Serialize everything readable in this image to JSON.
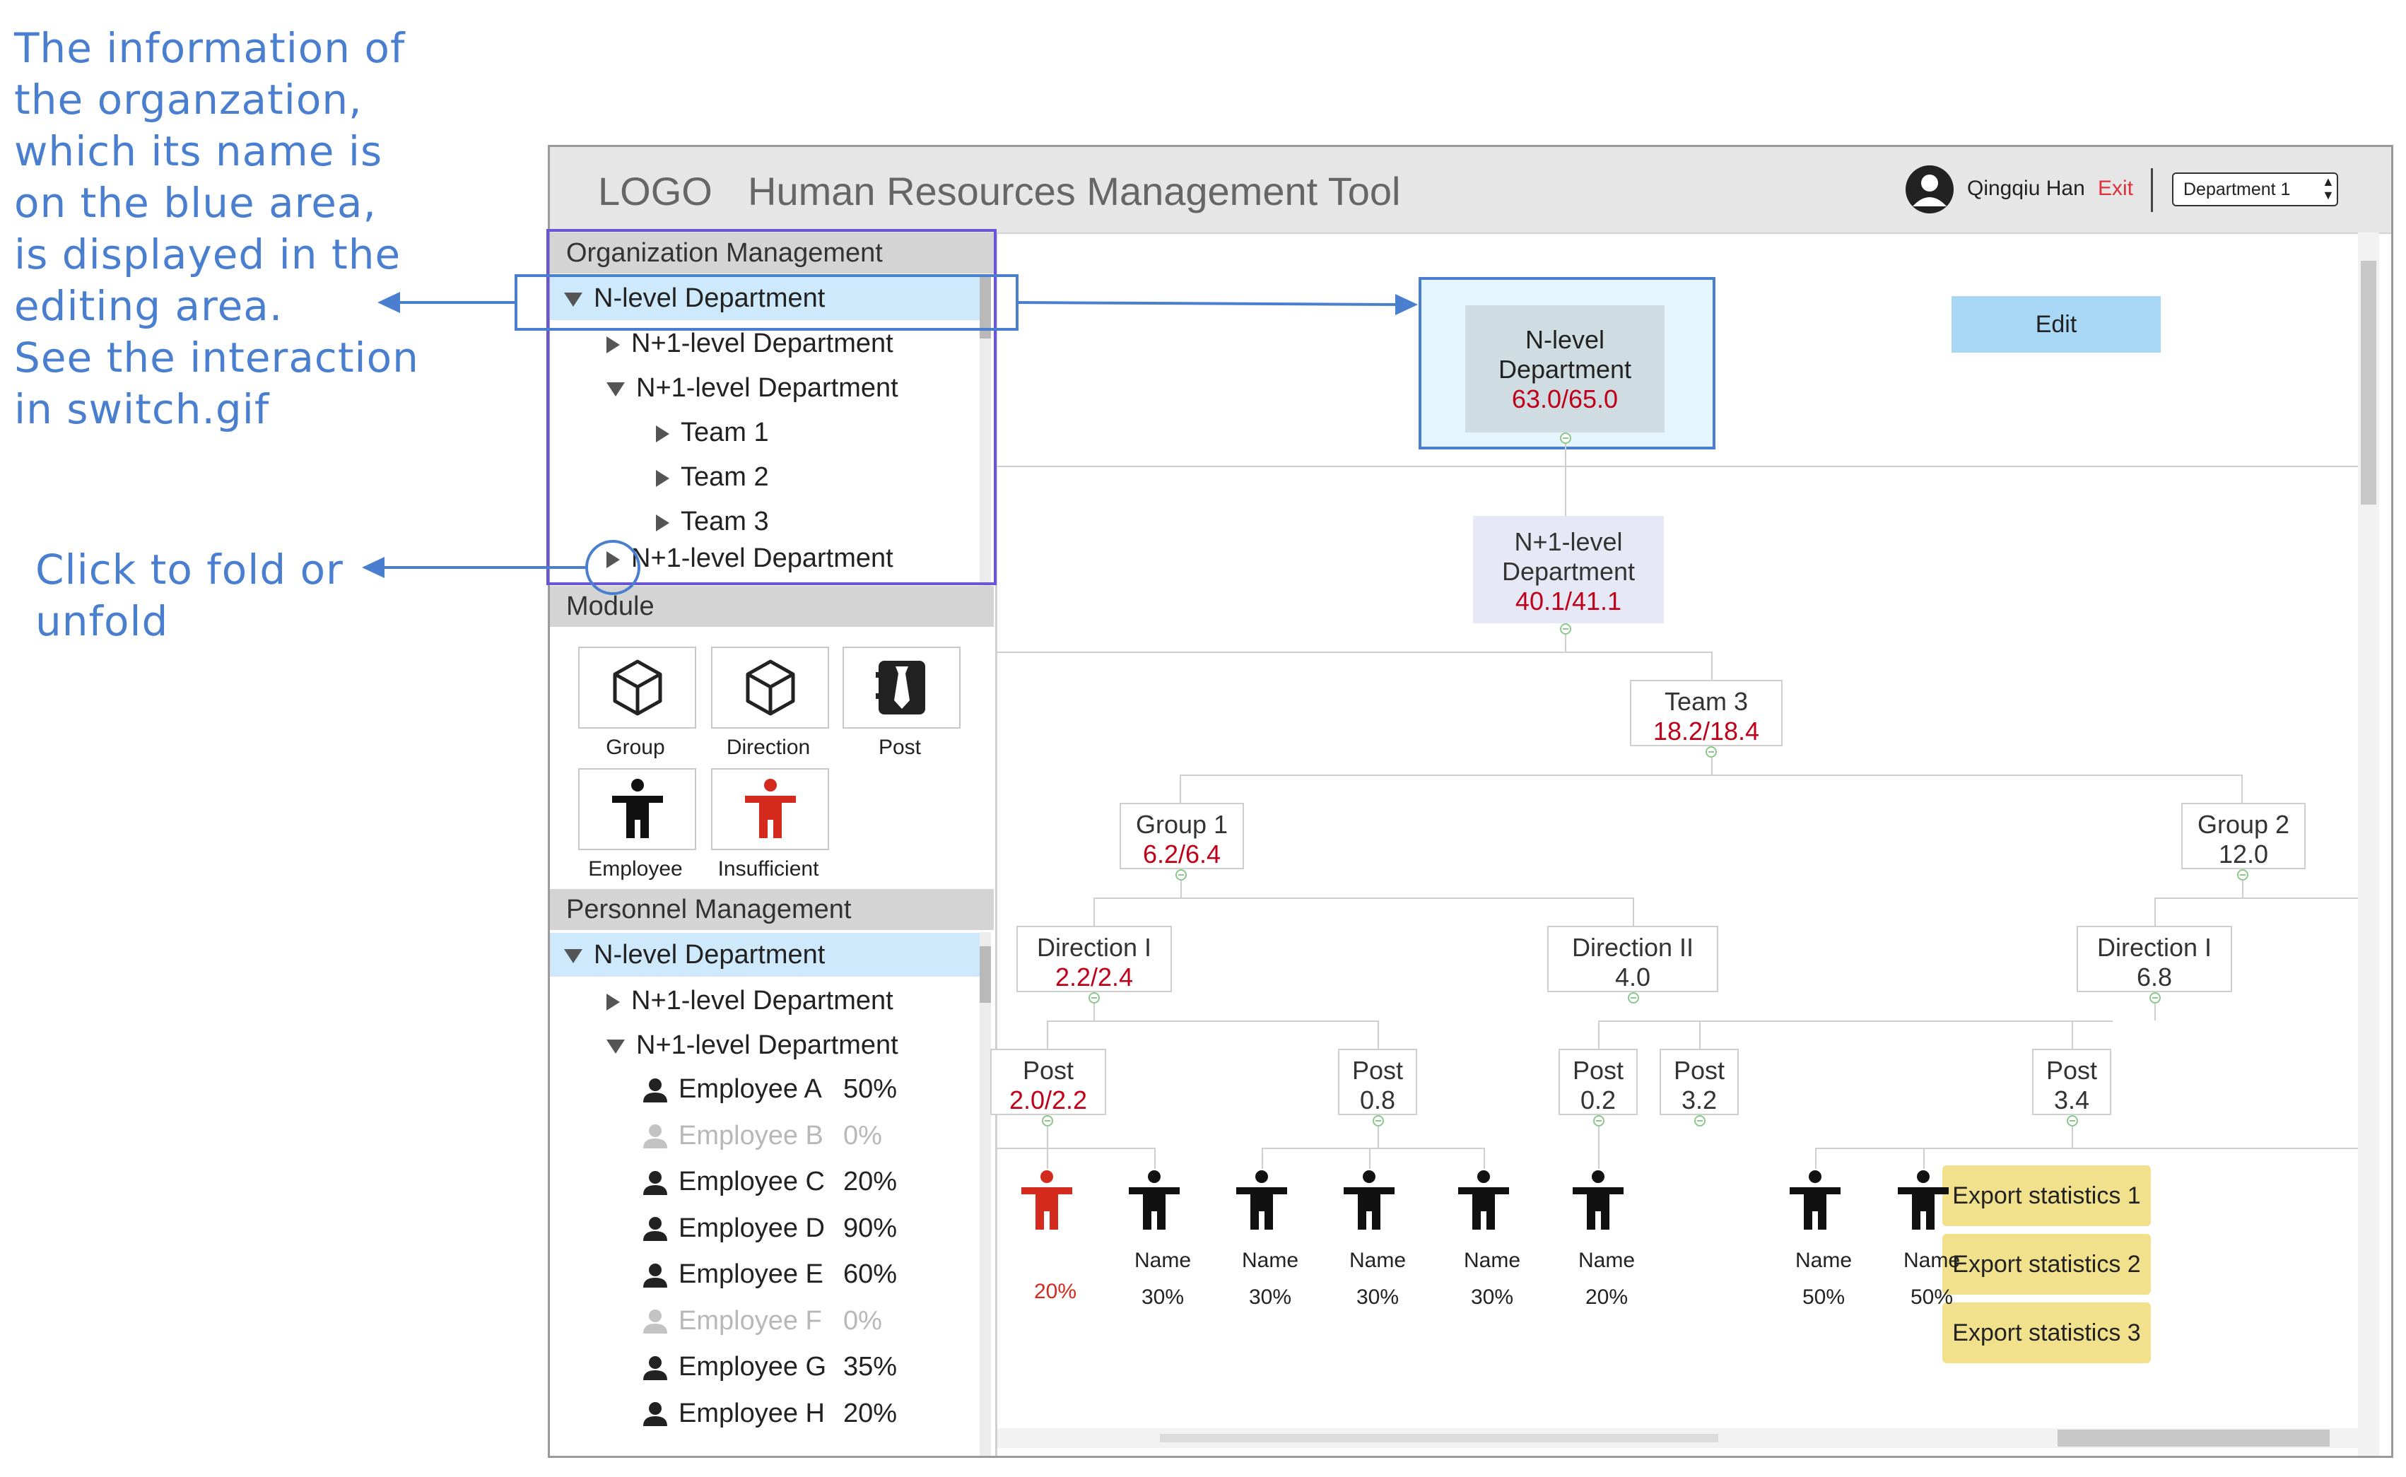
{
  "annotations": {
    "info": "The information of\nthe organzation,\nwhich its name is\non the blue area,\nis displayed in the\nediting area.\nSee the interaction\nin switch.gif",
    "fold": "Click to fold or\nunfold"
  },
  "header": {
    "logo": "LOGO",
    "title": "Human Resources Management Tool",
    "user": "Qingqiu Han",
    "exit": "Exit",
    "department_select": "Department 1"
  },
  "org_management": {
    "title": "Organization Management",
    "tree": [
      {
        "label": "N-level Department",
        "expanded": true
      },
      {
        "label": "N+1-level Department",
        "expanded": false
      },
      {
        "label": "N+1-level Department",
        "expanded": true
      },
      {
        "label": "Team 1",
        "expanded": false
      },
      {
        "label": "Team 2",
        "expanded": false
      },
      {
        "label": "Team 3",
        "expanded": false
      },
      {
        "label": "N+1-level Department",
        "expanded": false
      }
    ]
  },
  "module": {
    "title": "Module",
    "items": [
      {
        "label": "Group",
        "icon": "cube-icon"
      },
      {
        "label": "Direction",
        "icon": "cube-icon"
      },
      {
        "label": "Post",
        "icon": "tie-icon"
      },
      {
        "label": "Employee",
        "icon": "person-icon"
      },
      {
        "label": "Insufficient",
        "icon": "person-icon-red"
      }
    ]
  },
  "personnel": {
    "title": "Personnel Management",
    "tree": [
      {
        "label": "N-level Department"
      },
      {
        "label": "N+1-level Department"
      },
      {
        "label": "N+1-level Department"
      }
    ],
    "employees": [
      {
        "name": "Employee A",
        "pct": "50%",
        "dim": false
      },
      {
        "name": "Employee B",
        "pct": "0%",
        "dim": true
      },
      {
        "name": "Employee C",
        "pct": "20%",
        "dim": false
      },
      {
        "name": "Employee D",
        "pct": "90%",
        "dim": false
      },
      {
        "name": "Employee E",
        "pct": "60%",
        "dim": false
      },
      {
        "name": "Employee F",
        "pct": "0%",
        "dim": true
      },
      {
        "name": "Employee G",
        "pct": "35%",
        "dim": false
      },
      {
        "name": "Employee H",
        "pct": "20%",
        "dim": false
      }
    ]
  },
  "org_chart": {
    "edit_label": "Edit",
    "root": {
      "l1": "N-level",
      "l2": "Department",
      "value": "63.0/65.0"
    },
    "n1": {
      "l1": "N+1-level",
      "l2": "Department",
      "value": "40.1/41.1"
    },
    "team3": {
      "label": "Team 3",
      "value": "18.2/18.4"
    },
    "group1": {
      "label": "Group 1",
      "value": "6.2/6.4"
    },
    "group2": {
      "label": "Group 2",
      "value": "12.0"
    },
    "dir1_g1": {
      "label": "Direction I",
      "value": "2.2/2.4"
    },
    "dir2_g1": {
      "label": "Direction II",
      "value": "4.0"
    },
    "dir1_g2": {
      "label": "Direction I",
      "value": "6.8"
    },
    "post_a": {
      "label": "Post",
      "value": "2.0/2.2"
    },
    "post_b": {
      "label": "Post",
      "value": "0.8"
    },
    "post_c": {
      "label": "Post",
      "value": "0.2"
    },
    "post_d": {
      "label": "Post",
      "value": "3.2"
    },
    "post_e": {
      "label": "Post",
      "value": "3.4"
    },
    "people": [
      {
        "name": "",
        "pct": "20%",
        "red": true
      },
      {
        "name": "Name",
        "pct": "30%"
      },
      {
        "name": "Name",
        "pct": "30%"
      },
      {
        "name": "Name",
        "pct": "30%"
      },
      {
        "name": "Name",
        "pct": "30%"
      },
      {
        "name": "Name",
        "pct": "20%"
      },
      {
        "name": "Name",
        "pct": "50%"
      },
      {
        "name": "Name",
        "pct": "50%"
      }
    ],
    "exports": [
      "Export statistics 1",
      "Export statistics 2",
      "Export statistics 3"
    ]
  },
  "colors": {
    "accent_blue": "#4a7fd0",
    "selection": "#cde9fb",
    "red": "#c00018",
    "export": "#f1e18c"
  }
}
